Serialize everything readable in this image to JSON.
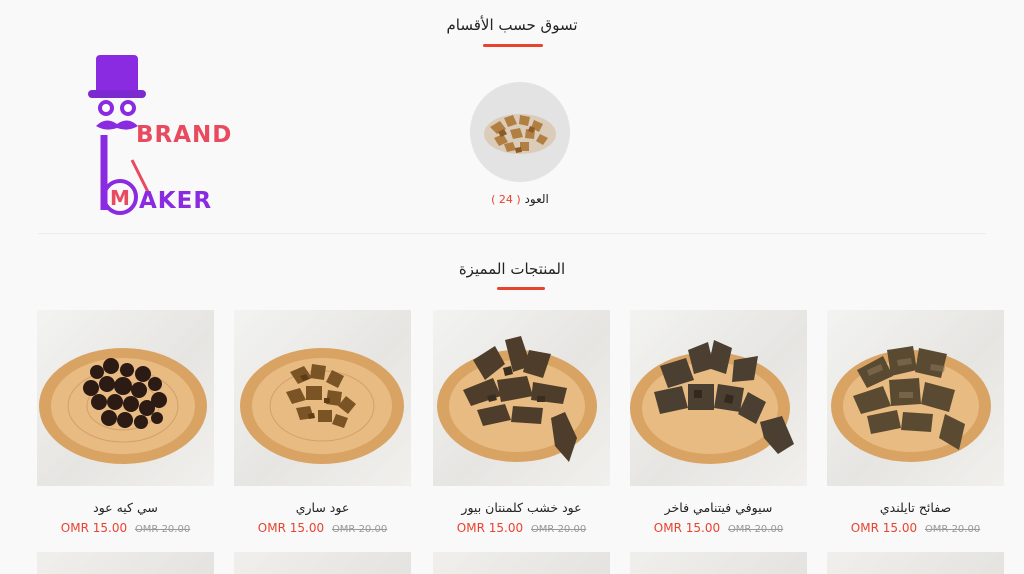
{
  "categories_section": {
    "title": "تسوق حسب الأقسام",
    "items": [
      {
        "name": "العود",
        "count": "( 24 )"
      }
    ]
  },
  "featured_section": {
    "title": "المنتجات المميزة"
  },
  "brand": {
    "line1": "BRAND",
    "line2": "AKER",
    "letter": "M"
  },
  "products": [
    {
      "name": "صفائح تايلندي",
      "price": "OMR 15.00",
      "old_price": "OMR 20.00"
    },
    {
      "name": "سيوفي فيتنامي فاخر",
      "price": "OMR 15.00",
      "old_price": "OMR 20.00"
    },
    {
      "name": "عود خشب كلمنتان بيور",
      "price": "OMR 15.00",
      "old_price": "OMR 20.00"
    },
    {
      "name": "عود ساري",
      "price": "OMR 15.00",
      "old_price": "OMR 20.00"
    },
    {
      "name": "سي كيه عود",
      "price": "OMR 15.00",
      "old_price": "OMR 20.00"
    }
  ],
  "colors": {
    "accent": "#e8432f",
    "brand_purple": "#8a2be2",
    "brand_red": "#e84a5f"
  }
}
